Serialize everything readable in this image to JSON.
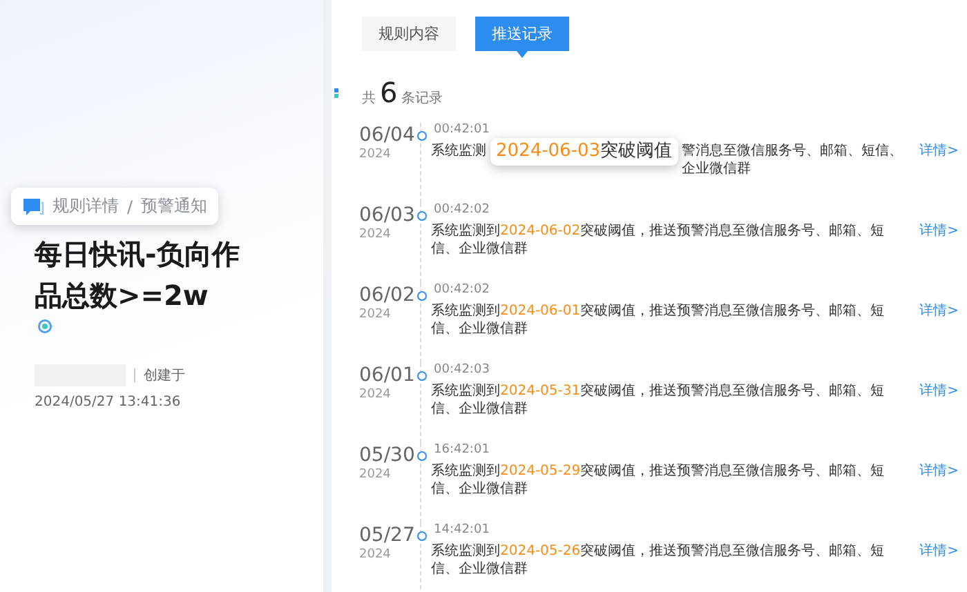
{
  "sidebar": {
    "breadcrumb": [
      "规则详情",
      "预警通知"
    ],
    "breadcrumb_separator": "/",
    "title": "每日快讯-负向作品总数>=2w",
    "creator_label": "创建于",
    "created_at": "2024/05/27 13:41:36"
  },
  "tabs": [
    {
      "label": "规则内容",
      "selected": false
    },
    {
      "label": "推送记录",
      "selected": true
    }
  ],
  "summary": {
    "prefix": "共",
    "count": "6",
    "suffix": "条记录"
  },
  "records": [
    {
      "kind": "magnified",
      "date": "06/04",
      "year": "2024",
      "time": "00:42:01",
      "prefix": "系统监测",
      "highlight": "2024-06-03",
      "middle": "突破阈值",
      "suffix": "警消息至微信服务号、邮箱、短信、企业微信群",
      "link": "详情>"
    },
    {
      "kind": "normal",
      "date": "06/03",
      "year": "2024",
      "time": "00:42:02",
      "prefix": "系统监测到",
      "highlight": "2024-06-02",
      "suffix": "突破阈值，推送预警消息至微信服务号、邮箱、短信、企业微信群",
      "link": "详情>"
    },
    {
      "kind": "normal",
      "date": "06/02",
      "year": "2024",
      "time": "00:42:02",
      "prefix": "系统监测到",
      "highlight": "2024-06-01",
      "suffix": "突破阈值，推送预警消息至微信服务号、邮箱、短信、企业微信群",
      "link": "详情>"
    },
    {
      "kind": "normal",
      "date": "06/01",
      "year": "2024",
      "time": "00:42:03",
      "prefix": "系统监测到",
      "highlight": "2024-05-31",
      "suffix": "突破阈值，推送预警消息至微信服务号、邮箱、短信、企业微信群",
      "link": "详情>"
    },
    {
      "kind": "normal",
      "date": "05/30",
      "year": "2024",
      "time": "16:42:01",
      "prefix": "系统监测到",
      "highlight": "2024-05-29",
      "suffix": "突破阈值，推送预警消息至微信服务号、邮箱、短信、企业微信群",
      "link": "详情>"
    },
    {
      "kind": "normal",
      "date": "05/27",
      "year": "2024",
      "time": "14:42:01",
      "prefix": "系统监测到",
      "highlight": "2024-05-26",
      "suffix": "突破阈值，推送预警消息至微信服务号、邮箱、短信、企业微信群",
      "link": "详情>"
    }
  ]
}
